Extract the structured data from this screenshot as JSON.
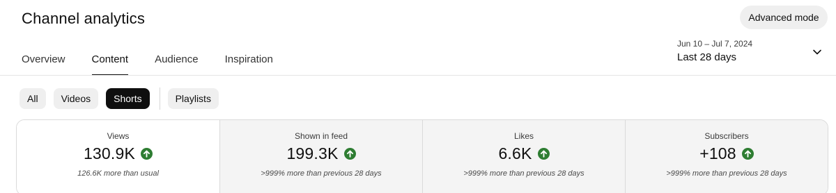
{
  "header": {
    "title": "Channel analytics",
    "advanced_mode_label": "Advanced mode"
  },
  "tabs": [
    {
      "label": "Overview",
      "active": false
    },
    {
      "label": "Content",
      "active": true
    },
    {
      "label": "Audience",
      "active": false
    },
    {
      "label": "Inspiration",
      "active": false
    }
  ],
  "date_picker": {
    "range": "Jun 10 – Jul 7, 2024",
    "label": "Last 28 days",
    "icon": "chevron-down-icon"
  },
  "chips": [
    {
      "label": "All",
      "active": false
    },
    {
      "label": "Videos",
      "active": false
    },
    {
      "label": "Shorts",
      "active": true
    },
    {
      "label": "Playlists",
      "active": false
    }
  ],
  "metrics": [
    {
      "label": "Views",
      "value": "130.9K",
      "trend": "up",
      "note": "126.6K more than usual"
    },
    {
      "label": "Shown in feed",
      "value": "199.3K",
      "trend": "up",
      "note": ">999% more than previous 28 days"
    },
    {
      "label": "Likes",
      "value": "6.6K",
      "trend": "up",
      "note": ">999% more than previous 28 days"
    },
    {
      "label": "Subscribers",
      "value": "+108",
      "trend": "up",
      "note": ">999% more than previous 28 days"
    }
  ],
  "colors": {
    "trend_up": "#2e7d32",
    "active_chip": "#0f0f0f",
    "chip": "#efefef",
    "card_unselected": "#f4f4f4"
  }
}
